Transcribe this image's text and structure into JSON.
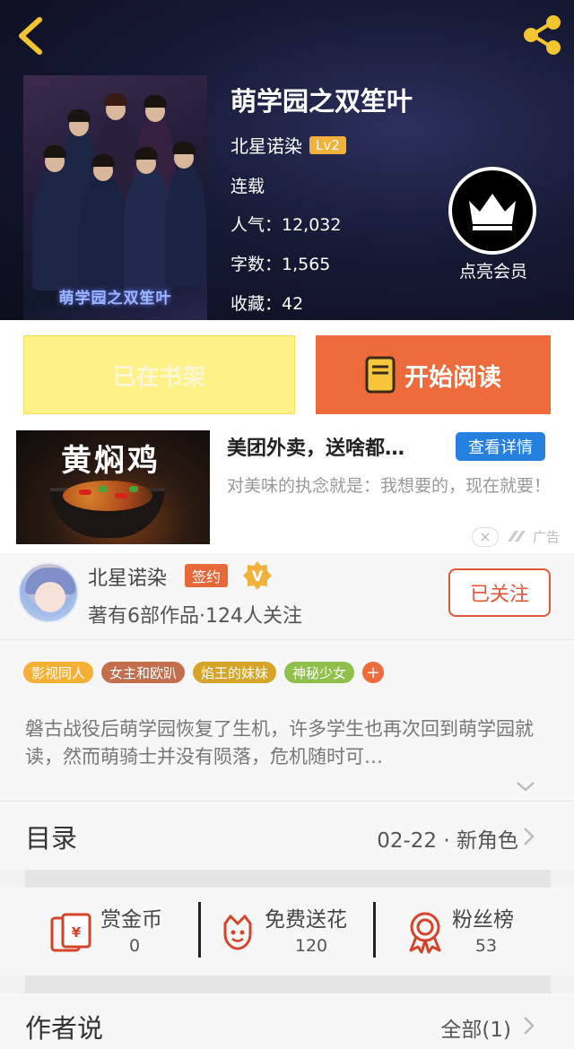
{
  "book": {
    "title": "萌学园之双笙叶",
    "cover_text": "萌学园之双笙叶",
    "author": "北星诺染",
    "level": "Lv2",
    "status": "连载",
    "popularity": "人气：12,032",
    "word_count": "字数：1,565",
    "favorites": "收藏：42"
  },
  "vip": {
    "label": "点亮会员"
  },
  "actions": {
    "shelf_label": "已在书架",
    "read_label": "开始阅读"
  },
  "ad": {
    "image_text": "黄焖鸡",
    "title": "美团外卖，送啥都…",
    "detail_button": "查看详情",
    "description": "对美味的执念就是：我想要的，现在就要！",
    "close_symbol": "×",
    "ad_mark": "广告"
  },
  "author_card": {
    "name": "北星诺染",
    "signed_badge": "签约",
    "verified_badge": "V",
    "stats": "著有6部作品·124人关注",
    "follow_button": "已关注"
  },
  "tags": [
    {
      "label": "影视同人",
      "color": "#f3b035"
    },
    {
      "label": "女主和欧趴",
      "color": "#c36e4c"
    },
    {
      "label": "焰王的妹妹",
      "color": "#d6a42a"
    },
    {
      "label": "神秘少女",
      "color": "#8fc04c"
    }
  ],
  "tag_more": "+",
  "description": "磐古战役后萌学园恢复了生机，许多学生也再次回到萌学园就读，然而萌骑士并没有陨落，危机随时可…",
  "catalog": {
    "title": "目录",
    "latest": "02-22 · 新角色"
  },
  "stats": {
    "reward": {
      "label": "赏金币",
      "value": "0"
    },
    "flowers": {
      "label": "免费送花",
      "value": "120"
    },
    "fans": {
      "label": "粉丝榜",
      "value": "53"
    }
  },
  "author_says": {
    "title": "作者说",
    "all": "全部(1)"
  },
  "colors": {
    "accent": "#ee6c3b",
    "shelf": "#fdf187",
    "ad_button": "#2580e0",
    "follow": "#e2563a",
    "icon_red": "#d4432a"
  }
}
